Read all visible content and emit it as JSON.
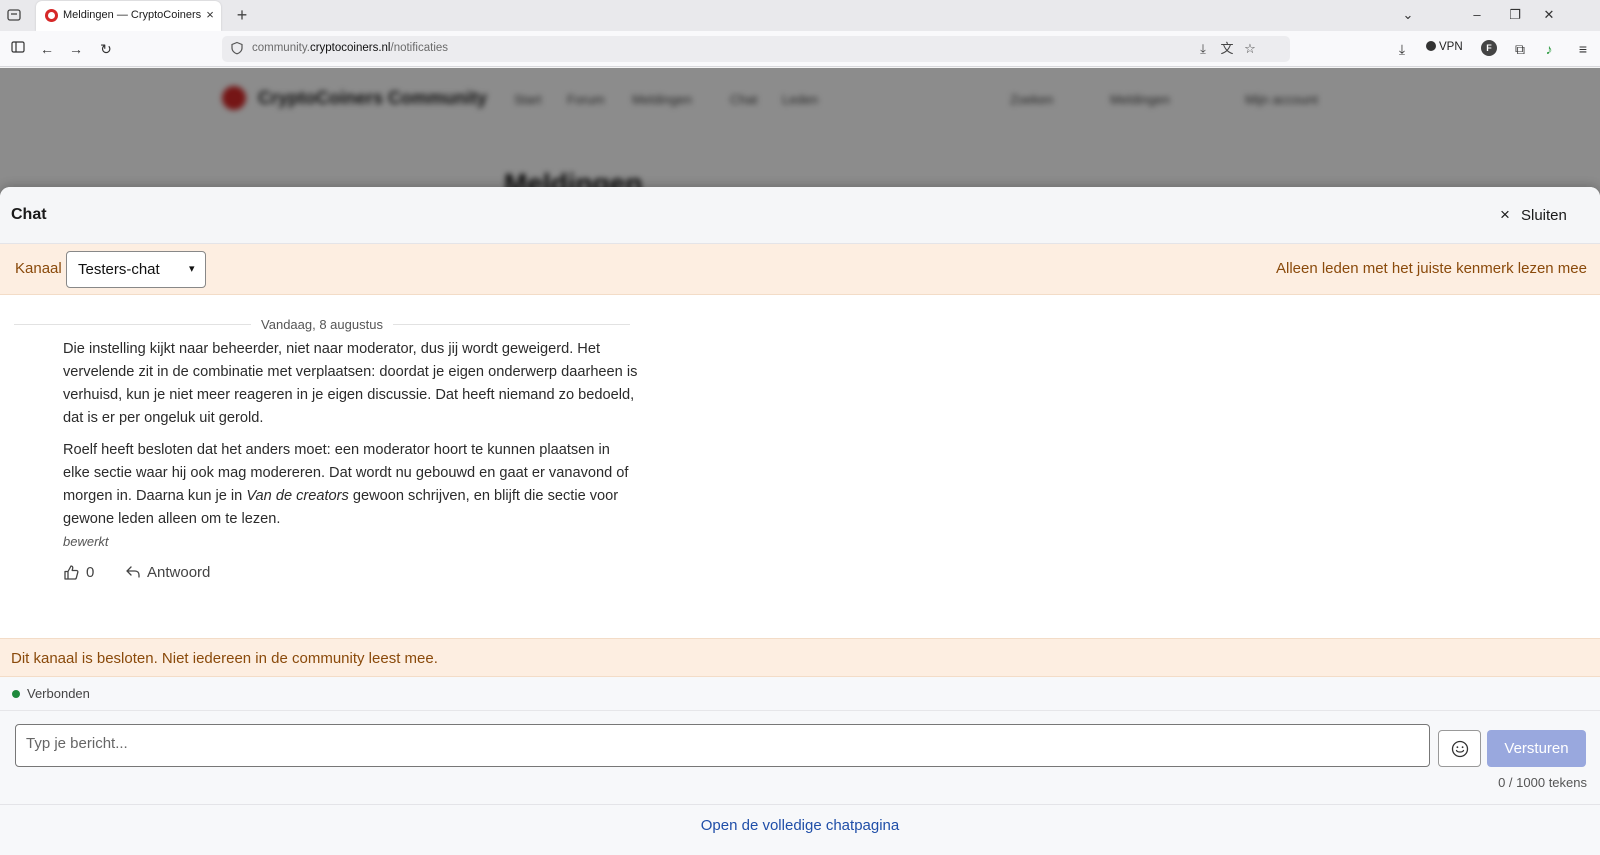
{
  "browser": {
    "tab_title": "Meldingen — CryptoCoiners Co",
    "tab_close": "×",
    "new_tab": "+",
    "url_host_prefix": "community.",
    "url_host": "cryptocoiners.nl",
    "url_path": "/notificaties",
    "vpn_label": "VPN",
    "profile_initial": "F"
  },
  "site": {
    "name": "CryptoCoiners Community",
    "nav": [
      "Start",
      "Forum",
      "Meldingen",
      "Chat",
      "Leden"
    ],
    "right_nav": [
      "Zoeken",
      "Meldingen",
      "Mijn account"
    ],
    "page_heading": "Meldingen"
  },
  "chat": {
    "title": "Chat",
    "close_label": "Sluiten",
    "channel_label": "Kanaal",
    "channel_selected": "Testers-chat",
    "channel_note": "Alleen leden met het juiste kenmerk lezen mee",
    "date_separator": "Vandaag, 8 augustus",
    "message": {
      "p1": "Die instelling kijkt naar beheerder, niet naar moderator, dus jij wordt geweigerd. Het vervelende zit in de combinatie met verplaatsen: doordat je eigen onderwerp daarheen is verhuisd, kun je niet meer reageren in je eigen discussie. Dat heeft niemand zo bedoeld, dat is er per ongeluk uit gerold.",
      "p2_before": "Roelf heeft besloten dat het anders moet: een moderator hoort te kunnen plaatsen in elke sectie waar hij ook mag modereren. Dat wordt nu gebouwd en gaat er vanavond of morgen in. Daarna kun je in ",
      "p2_em": "Van de creators",
      "p2_after": " gewoon schrijven, en blijft die sectie voor gewone leden alleen om te lezen.",
      "edited": "bewerkt",
      "likes": "0",
      "reply_label": "Antwoord"
    },
    "closed_notice": "Dit kanaal is besloten. Niet iedereen in de community leest mee.",
    "connection_status": "Verbonden",
    "input_placeholder": "Typ je bericht...",
    "send_label": "Versturen",
    "char_counter": "0 / 1000 tekens",
    "full_page_link": "Open de volledige chatpagina"
  },
  "colors": {
    "accent_warning_bg": "#fdeee1",
    "accent_warning_text": "#8a4a0b",
    "send_button": "#99a8de",
    "link": "#1f4ea8",
    "status_online": "#1f8a3c"
  }
}
